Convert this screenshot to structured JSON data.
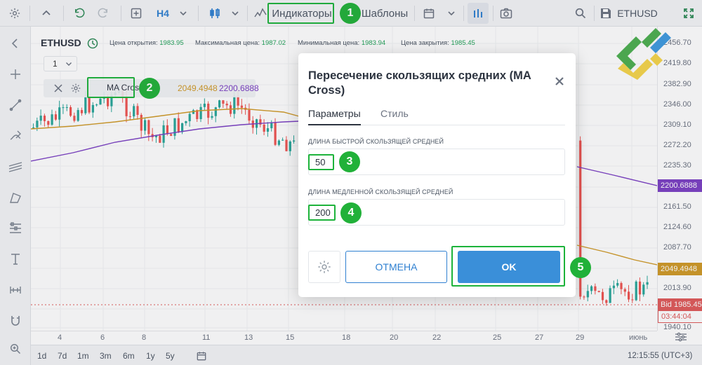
{
  "toolbar": {
    "timeframe": "H4",
    "indicators_label": "Индикаторы",
    "templates_label": "Шаблоны",
    "symbol": "ETHUSD"
  },
  "chart": {
    "symbol": "ETHUSD",
    "open_label": "Цена открытия:",
    "open_value": "1983.95",
    "high_label": "Максимальная цена:",
    "high_value": "1987.02",
    "low_label": "Минимальная цена:",
    "low_value": "1983.94",
    "close_label": "Цена закрытия:",
    "close_value": "1985.45",
    "interval": "1",
    "indicator_name": "MA Cross",
    "indicator_value_fast": "2049.4948",
    "indicator_value_slow": "2200.6888",
    "fast_ma_color": "#d09a27",
    "slow_ma_color": "#7b3fc4",
    "up_color": "#26a69a",
    "down_color": "#ef5350"
  },
  "price_axis": {
    "ticks": [
      "2456.70",
      "2419.80",
      "2382.90",
      "2346.00",
      "2309.10",
      "2272.20",
      "2235.30",
      "2161.50",
      "2124.60",
      "2087.70",
      "2013.90",
      "1940.10"
    ],
    "slow_ma_label": "2200.6888",
    "fast_ma_label": "2049.4948",
    "bid_label": "Bid 1985.45",
    "countdown": "03:44:04"
  },
  "time_axis": {
    "ticks": [
      "4",
      "6",
      "8",
      "11",
      "13",
      "15",
      "18",
      "20",
      "22",
      "25",
      "27",
      "29",
      "июнь"
    ]
  },
  "bottom_bar": {
    "ranges": [
      "1d",
      "7d",
      "1m",
      "3m",
      "6m",
      "1y",
      "5y"
    ],
    "clock": "12:15:55 (UTC+3)"
  },
  "dialog": {
    "title": "Пересечение скользящих средних (MA Cross)",
    "tab_params": "Параметры",
    "tab_style": "Стиль",
    "fast_label": "ДЛИНА БЫСТРОЙ СКОЛЬЗЯЩЕЙ СРЕДНЕЙ",
    "fast_value": "50",
    "slow_label": "ДЛИНА МЕДЛЕННОЙ СКОЛЬЗЯЩЕЙ СРЕДНЕЙ",
    "slow_value": "200",
    "cancel_label": "ОТМЕНА",
    "ok_label": "OK"
  },
  "callouts": [
    "1",
    "2",
    "3",
    "4",
    "5"
  ],
  "colors": {
    "accent": "#2f80d1",
    "highlight": "#1db33b"
  }
}
